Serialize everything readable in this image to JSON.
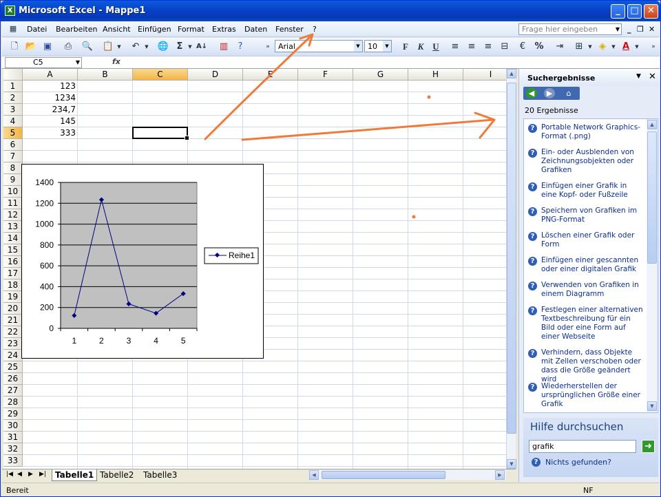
{
  "window": {
    "title": "Microsoft Excel - Mappe1",
    "app_icon": "X"
  },
  "menu": {
    "items": [
      "Datei",
      "Bearbeiten",
      "Ansicht",
      "Einfügen",
      "Format",
      "Extras",
      "Daten",
      "Fenster",
      "?"
    ],
    "ask_placeholder": "Frage hier eingeben"
  },
  "toolbar": {
    "font_name": "Arial",
    "font_size": "10"
  },
  "formula": {
    "name_box": "C5",
    "fx": "fx"
  },
  "sheet": {
    "columns": [
      "A",
      "B",
      "C",
      "D",
      "E",
      "F",
      "G",
      "H",
      "I"
    ],
    "selected_column": "C",
    "selected_row": "5",
    "rows": [
      "1",
      "2",
      "3",
      "4",
      "5",
      "6",
      "7",
      "8",
      "9",
      "10",
      "11",
      "12",
      "13",
      "14",
      "15",
      "16",
      "17",
      "18",
      "19",
      "20",
      "21",
      "22",
      "23",
      "24",
      "25",
      "26",
      "27",
      "28",
      "29",
      "30",
      "31",
      "32",
      "33"
    ],
    "cells_a": [
      "123",
      "1234",
      "234,7",
      "145",
      "333"
    ]
  },
  "chart_data": {
    "type": "line",
    "x": [
      1,
      2,
      3,
      4,
      5
    ],
    "series": [
      {
        "name": "Reihe1",
        "values": [
          123,
          1234,
          234.7,
          145,
          333
        ],
        "color": "#000080"
      }
    ],
    "x_tick_labels": [
      "1",
      "2",
      "3",
      "4",
      "5"
    ],
    "y_tick_labels": [
      "0",
      "200",
      "400",
      "600",
      "800",
      "1000",
      "1200",
      "1400"
    ],
    "ylim": [
      0,
      1400
    ],
    "grid": true,
    "plot_background": "#c0c0c0",
    "legend_position": "right"
  },
  "tabs": [
    "Tabelle1",
    "Tabelle2",
    "Tabelle3"
  ],
  "status": {
    "ready": "Bereit",
    "nf": "NF"
  },
  "taskpane": {
    "title": "Suchergebnisse",
    "count": "20 Ergebnisse",
    "results": [
      "Portable Network Graphics-Format (.png)",
      "Ein- oder Ausblenden von Zeichnungsobjekten oder Grafiken",
      "Einfügen einer Grafik in eine Kopf- oder Fußzeile",
      "Speichern von Grafiken im PNG-Format",
      "Löschen einer Grafik oder Form",
      "Einfügen einer gescannten oder einer digitalen Grafik",
      "Verwenden von Grafiken in einem Diagramm",
      "Festlegen einer alternativen Textbeschreibung für ein Bild oder eine Form auf einer Webseite",
      "Verhindern, dass Objekte mit Zellen verschoben oder dass die Größe geändert wird",
      "Wiederherstellen der ursprünglichen Größe einer Grafik"
    ],
    "search_title": "Hilfe durchsuchen",
    "search_value": "grafik",
    "nothing_found": "Nichts gefunden?"
  },
  "colors": {
    "accent": "#0a5be0",
    "annotation": "#f07a3a",
    "selection_header": "#f3b548"
  }
}
